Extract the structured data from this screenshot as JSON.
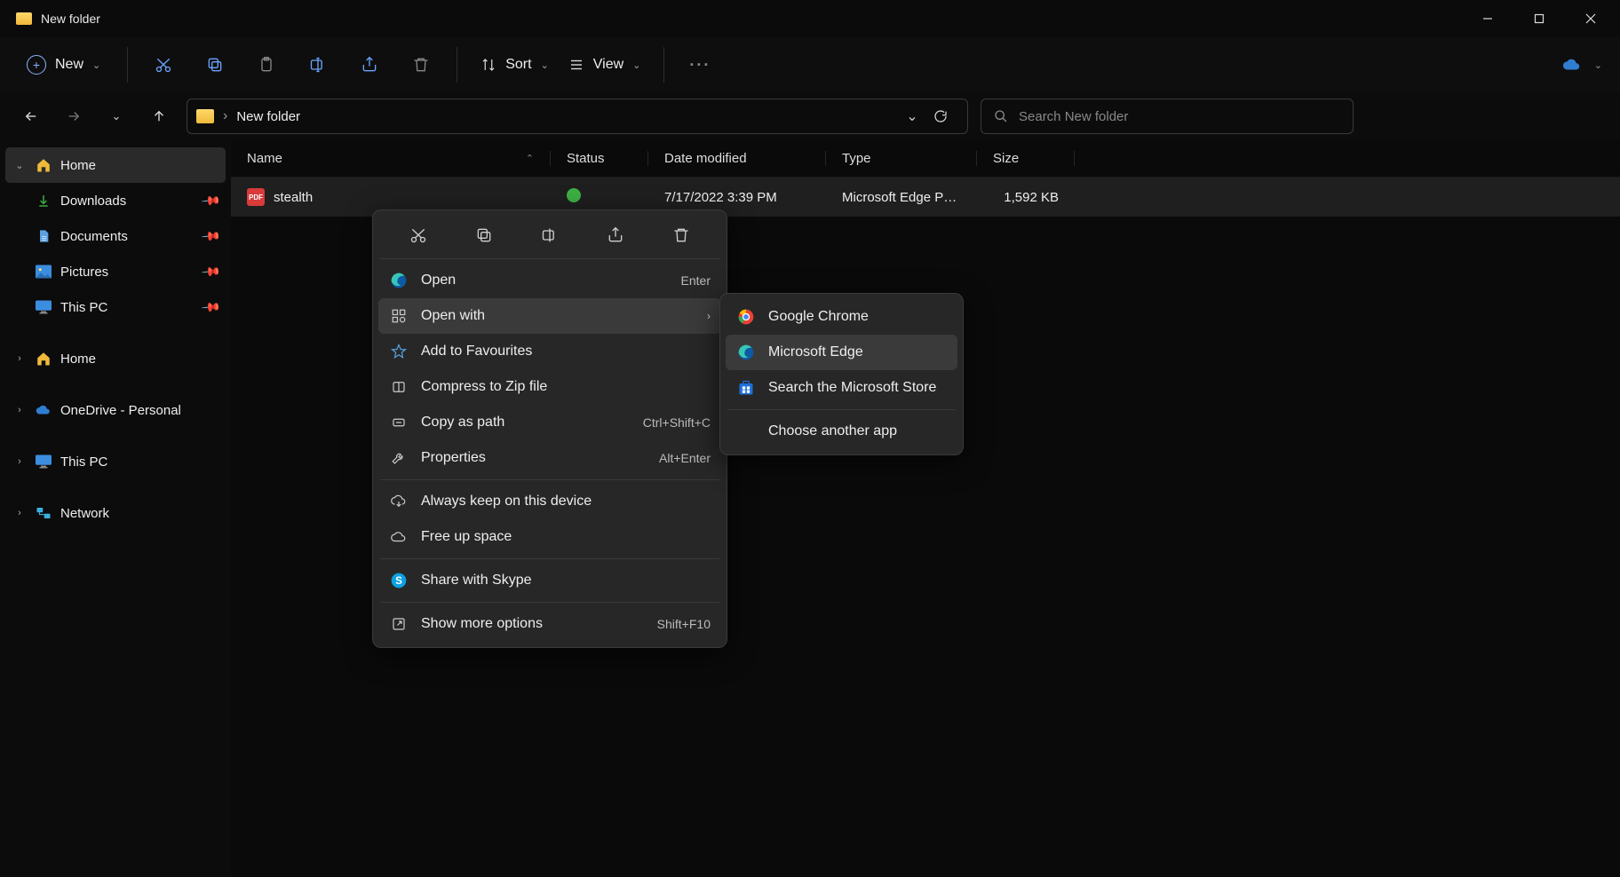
{
  "window": {
    "title": "New folder"
  },
  "toolbar": {
    "new_label": "New",
    "sort_label": "Sort",
    "view_label": "View"
  },
  "address": {
    "crumb": "New folder"
  },
  "search": {
    "placeholder": "Search New folder"
  },
  "sidebar": {
    "home": "Home",
    "downloads": "Downloads",
    "documents": "Documents",
    "pictures": "Pictures",
    "thispc_pinned": "This PC",
    "home2": "Home",
    "onedrive": "OneDrive - Personal",
    "thispc": "This PC",
    "network": "Network"
  },
  "columns": {
    "name": "Name",
    "status": "Status",
    "date": "Date modified",
    "type": "Type",
    "size": "Size"
  },
  "file": {
    "name": "stealth",
    "date": "7/17/2022 3:39 PM",
    "type": "Microsoft Edge PDF ...",
    "size": "1,592 KB"
  },
  "ctx": {
    "open": "Open",
    "open_accel": "Enter",
    "openwith": "Open with",
    "fav": "Add to Favourites",
    "zip": "Compress to Zip file",
    "copypath": "Copy as path",
    "copypath_accel": "Ctrl+Shift+C",
    "props": "Properties",
    "props_accel": "Alt+Enter",
    "keep": "Always keep on this device",
    "freeup": "Free up space",
    "skype": "Share with Skype",
    "more": "Show more options",
    "more_accel": "Shift+F10"
  },
  "submenu": {
    "chrome": "Google Chrome",
    "edge": "Microsoft Edge",
    "store": "Search the Microsoft Store",
    "choose": "Choose another app"
  }
}
